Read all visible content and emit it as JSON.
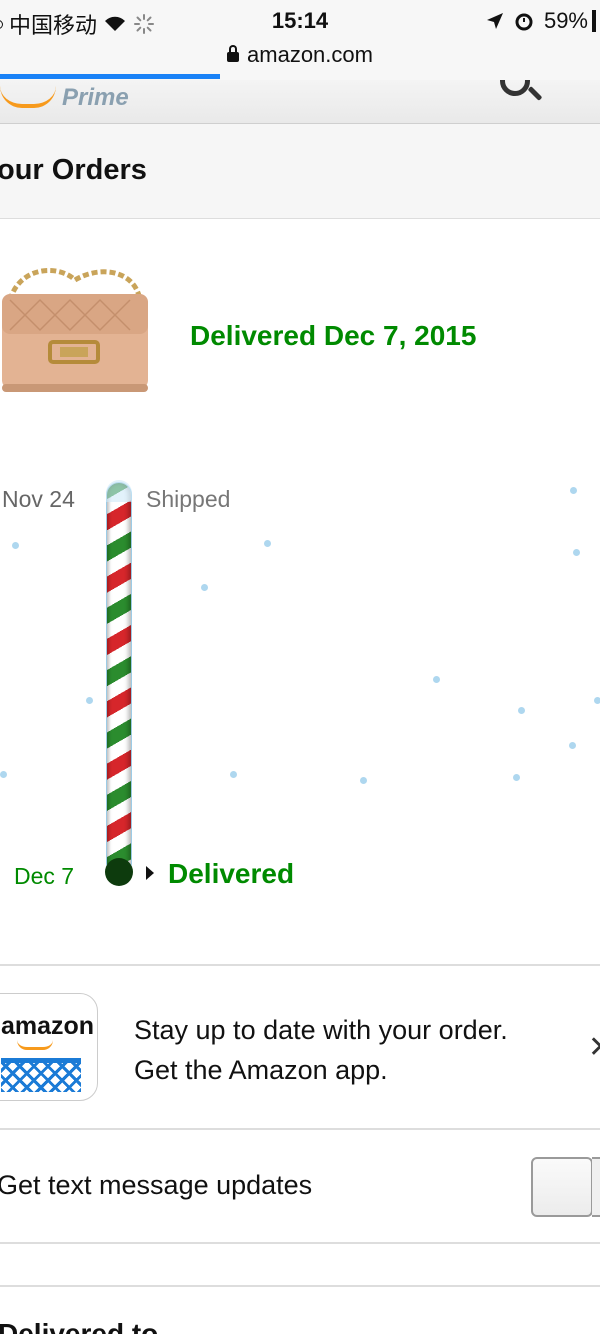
{
  "status_bar": {
    "carrier": "中国移动",
    "time": "15:14",
    "battery": "59%",
    "url": "amazon.com",
    "page_load_progress": 0.37
  },
  "header": {
    "prime_label": "Prime"
  },
  "orders": {
    "title": "our Orders"
  },
  "shipment": {
    "status_headline": "Delivered Dec 7, 2015",
    "timeline": {
      "start_date": "Nov 24",
      "start_event": "Shipped",
      "end_date": "Dec 7",
      "end_event": "Delivered"
    }
  },
  "app_promo": {
    "icon_wordmark": "amazon",
    "line1": "Stay up to date with your order.",
    "line2": "Get the Amazon app."
  },
  "sms": {
    "label": "Get text message updates"
  },
  "delivered_to": {
    "title": "Delivered to"
  },
  "colors": {
    "accent_green": "#008a00",
    "progress_blue": "#1a82f7",
    "amazon_orange": "#f79a1c"
  }
}
